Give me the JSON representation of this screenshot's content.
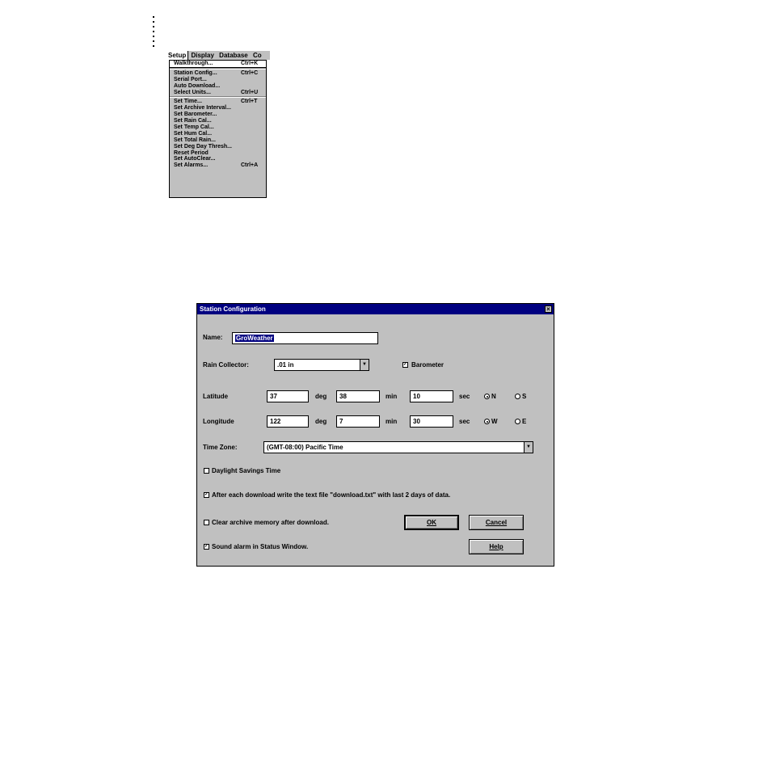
{
  "menubar": {
    "items": [
      "Setup",
      "Display",
      "Database",
      "Co"
    ]
  },
  "setup_menu": {
    "items": [
      {
        "label": "Walkthrough...",
        "shortcut": "Ctrl+K"
      },
      {
        "label": "Station Config...",
        "shortcut": "Ctrl+C"
      },
      {
        "label": "Serial Port...",
        "shortcut": ""
      },
      {
        "label": "Auto Download...",
        "shortcut": ""
      },
      {
        "label": "Select Units...",
        "shortcut": "Ctrl+U"
      },
      {
        "label": "Set Time...",
        "shortcut": "Ctrl+T"
      },
      {
        "label": "Set Archive Interval...",
        "shortcut": ""
      },
      {
        "label": "Set Barometer...",
        "shortcut": ""
      },
      {
        "label": "Set Rain Cal...",
        "shortcut": ""
      },
      {
        "label": "Set Temp Cal...",
        "shortcut": ""
      },
      {
        "label": "Set Hum Cal...",
        "shortcut": ""
      },
      {
        "label": "Set Total Rain...",
        "shortcut": ""
      },
      {
        "label": "Set Deg Day Thresh...",
        "shortcut": ""
      },
      {
        "label": "Reset Period",
        "shortcut": ""
      },
      {
        "label": "Set AutoClear...",
        "shortcut": ""
      },
      {
        "label": "Set Alarms...",
        "shortcut": "Ctrl+A"
      }
    ]
  },
  "dialog": {
    "title": "Station Configuration",
    "close_glyph": "×",
    "name_label": "Name:",
    "name_value": "GroWeather",
    "rain_label": "Rain Collector:",
    "rain_value": ".01 in",
    "dropdown_glyph": "▼",
    "barometer_label": "Barometer",
    "check_glyph": "✓",
    "latitude_label": "Latitude",
    "lat_deg": "37",
    "lat_min": "38",
    "lat_sec": "10",
    "longitude_label": "Longitude",
    "lon_deg": "122",
    "lon_min": "7",
    "lon_sec": "30",
    "deg_label": "deg",
    "min_label": "min",
    "sec_label": "sec",
    "n_label": "N",
    "s_label": "S",
    "w_label": "W",
    "e_label": "E",
    "timezone_label": "Time Zone:",
    "timezone_value": "(GMT-08:00) Pacific Time",
    "dst_label": "Daylight Savings Time",
    "download_label": "After each download write the text file \"download.txt\" with last 2 days of data.",
    "clear_label": "Clear archive memory after download.",
    "sound_label": "Sound alarm in Status Window.",
    "ok_label": "OK",
    "cancel_label": "Cancel",
    "help_label": "Help"
  }
}
